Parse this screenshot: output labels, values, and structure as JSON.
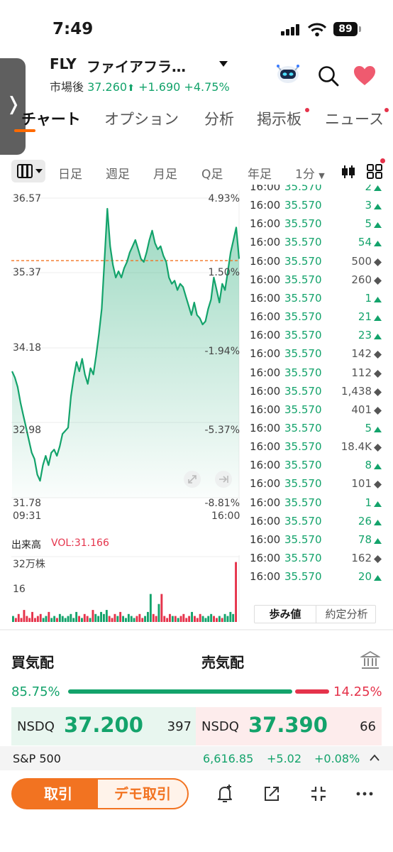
{
  "status_bar": {
    "time": "7:49",
    "battery": "89"
  },
  "header": {
    "ticker": "FLY",
    "name": "ファイアフラ…",
    "session_label": "市場後",
    "price": "37.260",
    "change": "+1.690",
    "change_pct": "+4.75%"
  },
  "tabs": [
    "チャート",
    "オプション",
    "分析",
    "掲示板",
    "ニュース"
  ],
  "periods": [
    "日足",
    "週足",
    "月足",
    "Q足",
    "年足",
    "1分"
  ],
  "chart": {
    "y_left": [
      "36.57",
      "35.37",
      "34.18",
      "32.98",
      "31.78"
    ],
    "y_right": [
      "4.93%",
      "1.50%",
      "-1.94%",
      "-5.37%",
      "-8.81%"
    ],
    "x_start": "09:31",
    "x_end": "16:00",
    "ref_price": 35.57,
    "volume_title": "出来高",
    "volume_value": "VOL:31.166",
    "volume_y_top": "32万株",
    "volume_y_mid": "16"
  },
  "chart_data": {
    "type": "line",
    "title": "",
    "ylim": [
      31.78,
      36.57
    ],
    "x_range": [
      "09:31",
      "16:00"
    ],
    "reference_line": 35.57,
    "series": [
      {
        "values": [
          33.8,
          33.7,
          33.55,
          33.3,
          33.1,
          32.9,
          32.7,
          32.5,
          32.4,
          32.15,
          32.05,
          32.3,
          32.45,
          32.3,
          32.5,
          32.55,
          32.45,
          32.6,
          32.8,
          32.85,
          32.9,
          33.4,
          33.7,
          33.95,
          33.8,
          34.0,
          33.75,
          33.6,
          33.85,
          33.75,
          34.05,
          34.4,
          34.8,
          35.6,
          36.4,
          35.8,
          35.5,
          35.3,
          35.4,
          35.3,
          35.45,
          35.55,
          35.7,
          35.8,
          35.9,
          35.75,
          35.6,
          35.55,
          35.7,
          35.9,
          36.05,
          35.85,
          35.75,
          35.8,
          35.65,
          35.55,
          35.3,
          35.2,
          35.25,
          35.1,
          35.2,
          35.15,
          35.0,
          34.85,
          34.7,
          34.9,
          34.7,
          34.65,
          34.55,
          34.6,
          34.8,
          34.95,
          35.3,
          35.1,
          34.9,
          35.2,
          35.1,
          35.4,
          35.7,
          35.9,
          36.1,
          35.6
        ]
      }
    ],
    "volume": [
      3,
      2,
      4,
      2,
      6,
      3,
      2,
      5,
      2,
      3,
      4,
      2,
      3,
      5,
      2,
      3,
      2,
      4,
      3,
      2,
      3,
      4,
      2,
      5,
      3,
      2,
      4,
      3,
      2,
      6,
      4,
      3,
      5,
      4,
      6,
      3,
      2,
      4,
      3,
      5,
      3,
      2,
      4,
      3,
      2,
      3,
      4,
      2,
      3,
      5,
      14,
      4,
      3,
      9,
      14,
      3,
      2,
      4,
      3,
      3,
      2,
      3,
      4,
      2,
      3,
      5,
      3,
      2,
      4,
      3,
      2,
      3,
      4,
      3,
      2,
      3,
      2,
      4,
      3,
      5,
      4,
      30
    ]
  },
  "ticks": [
    {
      "time": "16:00",
      "price": "35.570",
      "vol": "2",
      "dir": "up"
    },
    {
      "time": "16:00",
      "price": "35.570",
      "vol": "3",
      "dir": "up"
    },
    {
      "time": "16:00",
      "price": "35.570",
      "vol": "5",
      "dir": "up"
    },
    {
      "time": "16:00",
      "price": "35.570",
      "vol": "54",
      "dir": "up"
    },
    {
      "time": "16:00",
      "price": "35.570",
      "vol": "500",
      "dir": "neutral"
    },
    {
      "time": "16:00",
      "price": "35.570",
      "vol": "260",
      "dir": "neutral"
    },
    {
      "time": "16:00",
      "price": "35.570",
      "vol": "1",
      "dir": "up"
    },
    {
      "time": "16:00",
      "price": "35.570",
      "vol": "21",
      "dir": "up"
    },
    {
      "time": "16:00",
      "price": "35.570",
      "vol": "23",
      "dir": "up"
    },
    {
      "time": "16:00",
      "price": "35.570",
      "vol": "142",
      "dir": "neutral"
    },
    {
      "time": "16:00",
      "price": "35.570",
      "vol": "112",
      "dir": "neutral"
    },
    {
      "time": "16:00",
      "price": "35.570",
      "vol": "1,438",
      "dir": "neutral"
    },
    {
      "time": "16:00",
      "price": "35.570",
      "vol": "401",
      "dir": "neutral"
    },
    {
      "time": "16:00",
      "price": "35.570",
      "vol": "5",
      "dir": "up"
    },
    {
      "time": "16:00",
      "price": "35.570",
      "vol": "18.4K",
      "dir": "neutral"
    },
    {
      "time": "16:00",
      "price": "35.570",
      "vol": "8",
      "dir": "up"
    },
    {
      "time": "16:00",
      "price": "35.570",
      "vol": "101",
      "dir": "neutral"
    },
    {
      "time": "16:00",
      "price": "35.570",
      "vol": "1",
      "dir": "up"
    },
    {
      "time": "16:00",
      "price": "35.570",
      "vol": "26",
      "dir": "up"
    },
    {
      "time": "16:00",
      "price": "35.570",
      "vol": "78",
      "dir": "up"
    },
    {
      "time": "16:00",
      "price": "35.570",
      "vol": "162",
      "dir": "neutral"
    },
    {
      "time": "16:00",
      "price": "35.570",
      "vol": "20",
      "dir": "up"
    }
  ],
  "tick_tabs": {
    "trades": "歩み値",
    "analysis": "約定分析"
  },
  "order_book": {
    "buy_title": "買気配",
    "sell_title": "売気配",
    "buy_pct": "85.75%",
    "sell_pct": "14.25%",
    "buy_fraction": 0.8575,
    "bid": {
      "exchange": "NSDQ",
      "price": "37.200",
      "size": "397"
    },
    "ask": {
      "exchange": "NSDQ",
      "price": "37.390",
      "size": "66"
    }
  },
  "index_bar": {
    "name": "S&P 500",
    "value": "6,616.85",
    "change": "+5.02",
    "change_pct": "+0.08%"
  },
  "bottom": {
    "trade": "取引",
    "demo": "デモ取引"
  },
  "colors": {
    "up": "#13a36b",
    "down": "#e5334b",
    "accent": "#f27321"
  },
  "icons": [
    "side-panel-chevron-icon",
    "robot-assistant-icon",
    "search-icon",
    "heart-icon",
    "layout-icon",
    "candlestick-icon",
    "grid-icon",
    "expand-icon",
    "jump-to-end-icon",
    "bank-icon",
    "bell-add-icon",
    "share-icon",
    "collapse-icon",
    "more-icon"
  ]
}
